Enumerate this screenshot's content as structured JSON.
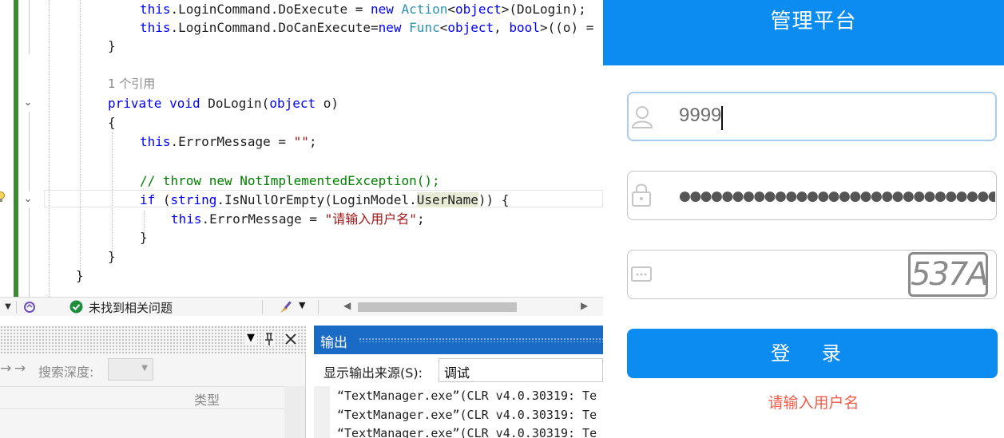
{
  "editor": {
    "lines": [
      [
        "this.LoginCommand.DoExecute = new Action<object>(DoLogin);"
      ],
      [
        "this.LoginCommand.DoCanExecute=new Func<object, bool>((o) ="
      ],
      [
        "}"
      ],
      [
        "1 个引用"
      ],
      [
        "private void DoLogin(object o)"
      ],
      [
        "{"
      ],
      [
        "this.ErrorMessage = \"\";"
      ],
      [
        "// throw new NotImplementedException();"
      ],
      [
        "if (string.IsNullOrEmpty(LoginModel.UserName)) {"
      ],
      [
        "this.ErrorMessage = \"请输入用户名\";"
      ],
      [
        "}"
      ],
      [
        "}"
      ],
      [
        "}"
      ]
    ],
    "ref_count": "1 个引用",
    "tokens": {
      "this": "this",
      "login_command": ".LoginCommand.",
      "do_execute": "DoExecute",
      "eq": " = ",
      "eq_tight": "=",
      "new": "new",
      "action": "Action",
      "object": "object",
      "lt": "<",
      "gt": ">",
      "do_login_arg": "(DoLogin);",
      "do_can_execute": "DoCanExecute",
      "func": "Func",
      "comma": ", ",
      "bool": "bool",
      "lambda": "((o) =",
      "private": "private",
      "void": "void",
      "do_login": " DoLogin(",
      "o": " o)",
      "open": "{",
      "close": "}",
      "error_message": ".ErrorMessage",
      "empty_str": "\"\"",
      "semi": ";",
      "comment": "// throw new NotImplementedException();",
      "if": "if",
      "string": "string",
      "is_null": ".IsNullOrEmpty(LoginModel.",
      "user_name": "UserName",
      "if_tail": ")) {",
      "err_str": "\"请输入用户名\"",
      "paren_open": " (",
      "space": " "
    }
  },
  "status_bar": {
    "issues_text": "未找到相关问题"
  },
  "bottom_left": {
    "search_depth_label": "搜索深度:",
    "column_type": "类型"
  },
  "output_panel": {
    "title": "输出",
    "source_label": "显示输出来源(S):",
    "source_value": "调试",
    "lines": [
      "“TextManager.exe”(CLR v4.0.30319: Te",
      "“TextManager.exe”(CLR v4.0.30319: Te",
      "“TextManager.exe”(CLR v4.0.30319: Te"
    ]
  },
  "login_app": {
    "title": "管理平台",
    "username_value": "9999",
    "password_mask": "●●●●●●●●●●●●●●●●●●●●●●●●●●●●●●●",
    "captcha_text": "537A",
    "login_button": "登 录",
    "error_message": "请输入用户名",
    "colors": {
      "primary": "#0c8cf0",
      "error": "#f25c4a"
    }
  },
  "icons": [
    "lightbulb-icon",
    "chevron-down-icon",
    "issues-ok-icon",
    "brush-icon",
    "pin-icon",
    "close-icon",
    "user-icon",
    "lock-icon",
    "captcha-icon"
  ]
}
